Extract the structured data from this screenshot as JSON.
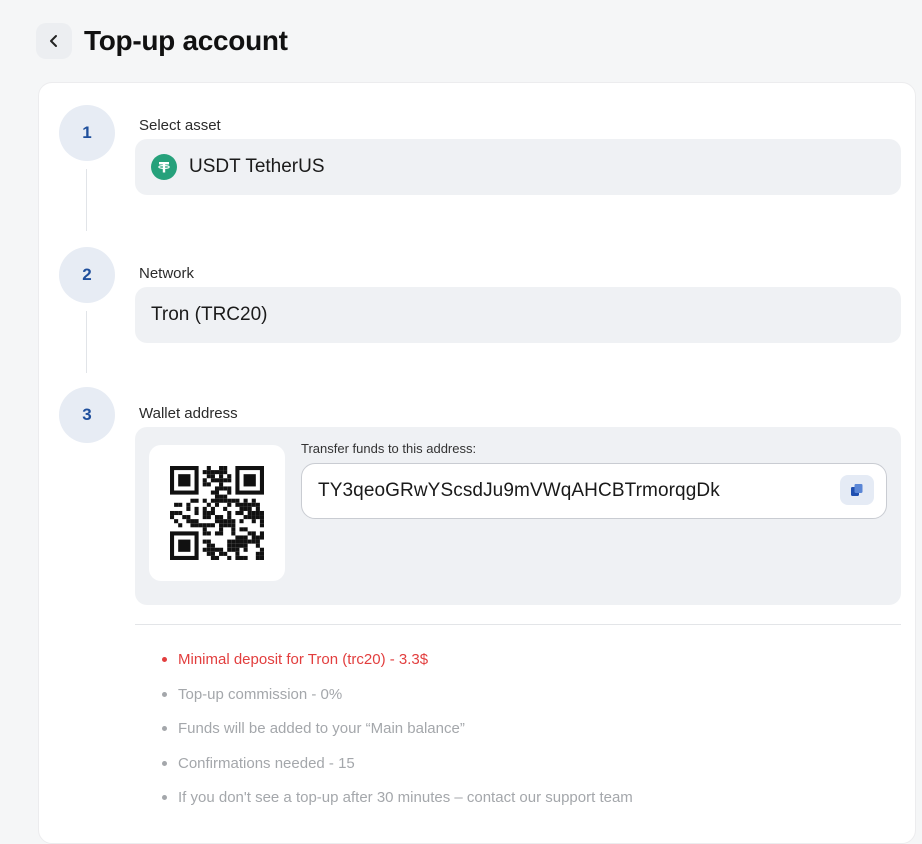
{
  "header": {
    "title": "Top-up account",
    "back_icon": "chevron-left-icon"
  },
  "steps": [
    {
      "number": "1",
      "label": "Select asset",
      "value": "USDT TetherUS",
      "icon": "tether-icon",
      "icon_color": "#26a17b"
    },
    {
      "number": "2",
      "label": "Network",
      "value": "Tron (TRC20)"
    },
    {
      "number": "3",
      "label": "Wallet address",
      "transfer_label": "Transfer funds to this address:",
      "address": "TY3qeoGRwYScsdJu9mVWqAHCBTrmorqgDk",
      "copy_icon": "copy-icon"
    }
  ],
  "notes": [
    {
      "text": "Minimal deposit for Tron (trc20) - 3.3$",
      "highlight": true,
      "color": "#e23e3e"
    },
    {
      "text": "Top-up commission - 0%"
    },
    {
      "text": "Funds will be added to your “Main balance”"
    },
    {
      "text": "Confirmations needed - 15"
    },
    {
      "text": "If you don't see a top-up after 30 minutes – contact our support team"
    }
  ],
  "colors": {
    "accent": "#1f4f9c",
    "step_bg": "#e7ecf4",
    "field_bg": "#eff1f4",
    "warning": "#e23e3e",
    "muted": "#a4a7ab"
  }
}
